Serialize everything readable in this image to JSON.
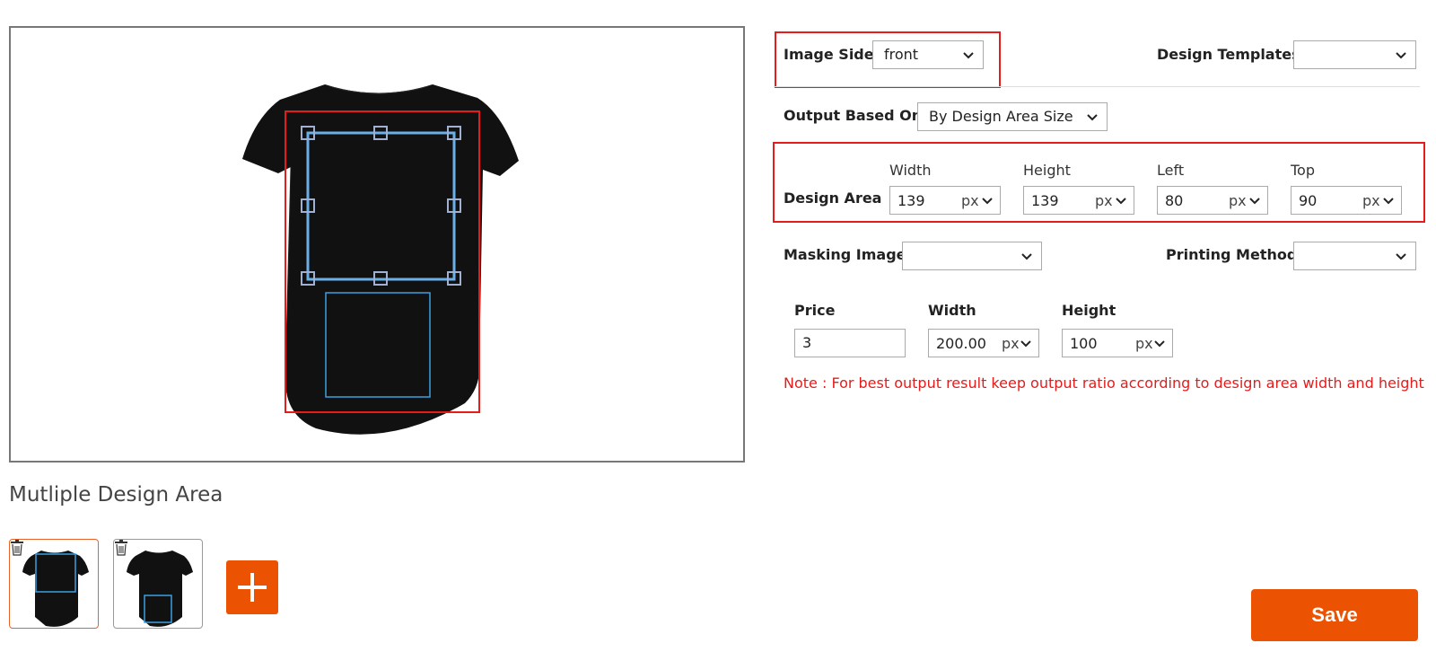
{
  "left": {
    "section_title": "Mutliple Design Area"
  },
  "right": {
    "image_side": {
      "label": "Image Side",
      "value": "front"
    },
    "design_templates": {
      "label": "Design Templates",
      "value": ""
    },
    "output_based_on": {
      "label": "Output Based On",
      "value": "By Design Area Size"
    },
    "design_area": {
      "label": "Design Area",
      "width": {
        "label": "Width",
        "value": "139",
        "unit": "px"
      },
      "height": {
        "label": "Height",
        "value": "139",
        "unit": "px"
      },
      "left": {
        "label": "Left",
        "value": "80",
        "unit": "px"
      },
      "top": {
        "label": "Top",
        "value": "90",
        "unit": "px"
      }
    },
    "masking_image": {
      "label": "Masking Image",
      "value": ""
    },
    "printing_method": {
      "label": "Printing Method",
      "value": ""
    },
    "output": {
      "price": {
        "label": "Price",
        "value": "3"
      },
      "width": {
        "label": "Width",
        "value": "200.00",
        "unit": "px"
      },
      "height": {
        "label": "Height",
        "value": "100",
        "unit": "px"
      }
    },
    "note": "Note : For best output result keep output ratio according to design area width and height"
  },
  "actions": {
    "save": "Save"
  },
  "colors": {
    "accent": "#eb5202",
    "highlight": "#e41c1c",
    "design_box": "#3aa0e0"
  }
}
